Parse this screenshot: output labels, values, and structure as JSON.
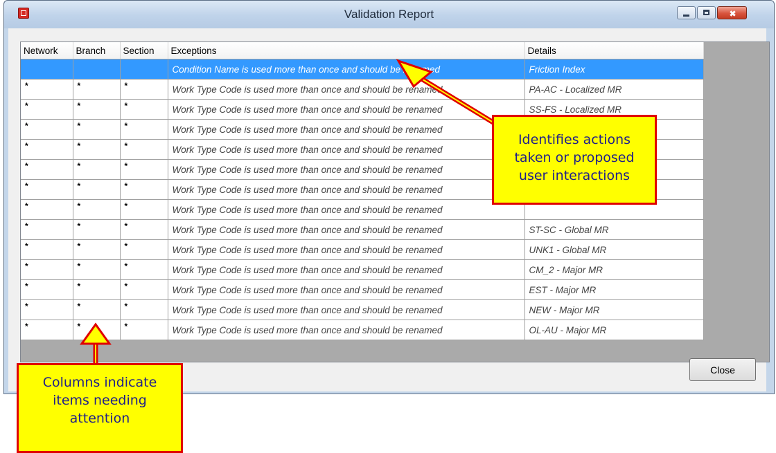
{
  "window": {
    "title": "Validation Report",
    "icon": "app-icon"
  },
  "grid": {
    "columns": [
      "Network",
      "Branch",
      "Section",
      "Exceptions",
      "Details"
    ],
    "rows": [
      {
        "network": "",
        "branch": "",
        "section": "",
        "exception": "Condition Name is used more than once and should be renamed",
        "details": "Friction Index",
        "selected": true
      },
      {
        "network": "*",
        "branch": "*",
        "section": "*",
        "exception": "Work Type Code is used more than once and should be renamed",
        "details": "PA-AC - Localized MR"
      },
      {
        "network": "*",
        "branch": "*",
        "section": "*",
        "exception": "Work Type Code is used more than once and should be renamed",
        "details": "SS-FS - Localized MR"
      },
      {
        "network": "*",
        "branch": "*",
        "section": "*",
        "exception": "Work Type Code is used more than once and should be renamed",
        "details": ""
      },
      {
        "network": "*",
        "branch": "*",
        "section": "*",
        "exception": "Work Type Code is used more than once and should be renamed",
        "details": ""
      },
      {
        "network": "*",
        "branch": "*",
        "section": "*",
        "exception": "Work Type Code is used more than once and should be renamed",
        "details": ""
      },
      {
        "network": "*",
        "branch": "*",
        "section": "*",
        "exception": "Work Type Code is used more than once and should be renamed",
        "details": ""
      },
      {
        "network": "*",
        "branch": "*",
        "section": "*",
        "exception": "Work Type Code is used more than once and should be renamed",
        "details": ""
      },
      {
        "network": "*",
        "branch": "*",
        "section": "*",
        "exception": "Work Type Code is used more than once and should be renamed",
        "details": "ST-SC - Global MR"
      },
      {
        "network": "*",
        "branch": "*",
        "section": "*",
        "exception": "Work Type Code is used more than once and should be renamed",
        "details": "UNK1 - Global MR"
      },
      {
        "network": "*",
        "branch": "*",
        "section": "*",
        "exception": "Work Type Code is used more than once and should be renamed",
        "details": "CM_2 - Major MR"
      },
      {
        "network": "*",
        "branch": "*",
        "section": "*",
        "exception": "Work Type Code is used more than once and should be renamed",
        "details": "EST - Major MR"
      },
      {
        "network": "*",
        "branch": "*",
        "section": "*",
        "exception": "Work Type Code is used more than once and should be renamed",
        "details": "NEW - Major MR"
      },
      {
        "network": "*",
        "branch": "*",
        "section": "*",
        "exception": "Work Type Code is used more than once and should be renamed",
        "details": "OL-AU - Major MR"
      }
    ]
  },
  "buttons": {
    "close": "Close"
  },
  "callouts": {
    "actions": "Identifies actions\ntaken or proposed\nuser interactions",
    "columns": "Columns indicate\nitems needing\nattention"
  },
  "colors": {
    "selection": "#3399ff",
    "callout_fill": "#ffff00",
    "callout_border": "#e00000",
    "callout_text": "#1f1f8a"
  }
}
